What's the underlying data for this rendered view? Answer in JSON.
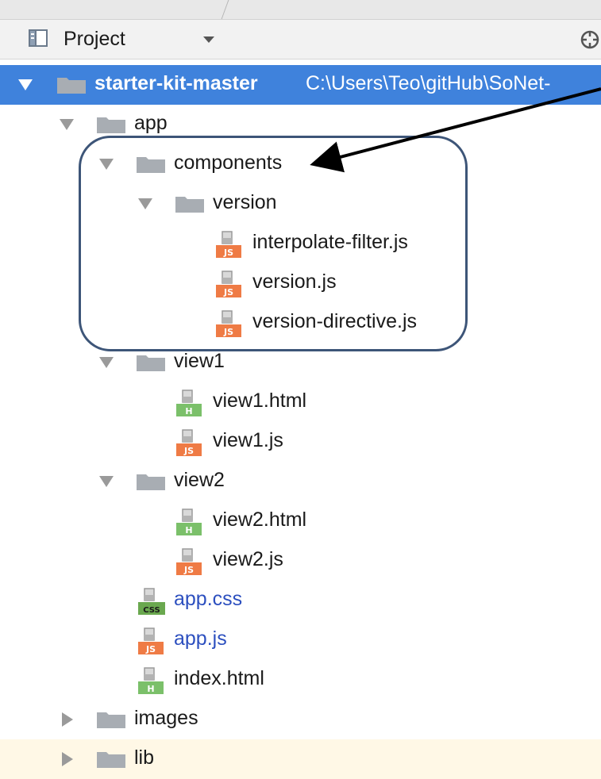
{
  "panel": {
    "title": "Project",
    "icon": "project-panel-icon",
    "locate_icon": "locate-crosshair-icon"
  },
  "colors": {
    "selection": "#3f82dc",
    "js_badge": "#ef7b45",
    "html_badge": "#7bc06a",
    "css_badge": "#6aa84f",
    "folder": "#a8adb3",
    "highlight_border": "#3d5578"
  },
  "tree": {
    "root": {
      "label": "starter-kit-master",
      "path": "C:\\Users\\Teo\\gitHub\\SoNet-"
    },
    "app": {
      "label": "app"
    },
    "components": {
      "label": "components"
    },
    "version": {
      "label": "version"
    },
    "interpolate_filter": {
      "label": "interpolate-filter.js",
      "badge": "JS"
    },
    "version_js": {
      "label": "version.js",
      "badge": "JS"
    },
    "version_directive": {
      "label": "version-directive.js",
      "badge": "JS"
    },
    "view1": {
      "label": "view1"
    },
    "view1_html": {
      "label": "view1.html",
      "badge": "H"
    },
    "view1_js": {
      "label": "view1.js",
      "badge": "JS"
    },
    "view2": {
      "label": "view2"
    },
    "view2_html": {
      "label": "view2.html",
      "badge": "H"
    },
    "view2_js": {
      "label": "view2.js",
      "badge": "JS"
    },
    "app_css": {
      "label": "app.css",
      "badge": "CSS"
    },
    "app_js": {
      "label": "app.js",
      "badge": "JS"
    },
    "index_html": {
      "label": "index.html",
      "badge": "H"
    },
    "images": {
      "label": "images"
    },
    "lib": {
      "label": "lib"
    }
  }
}
